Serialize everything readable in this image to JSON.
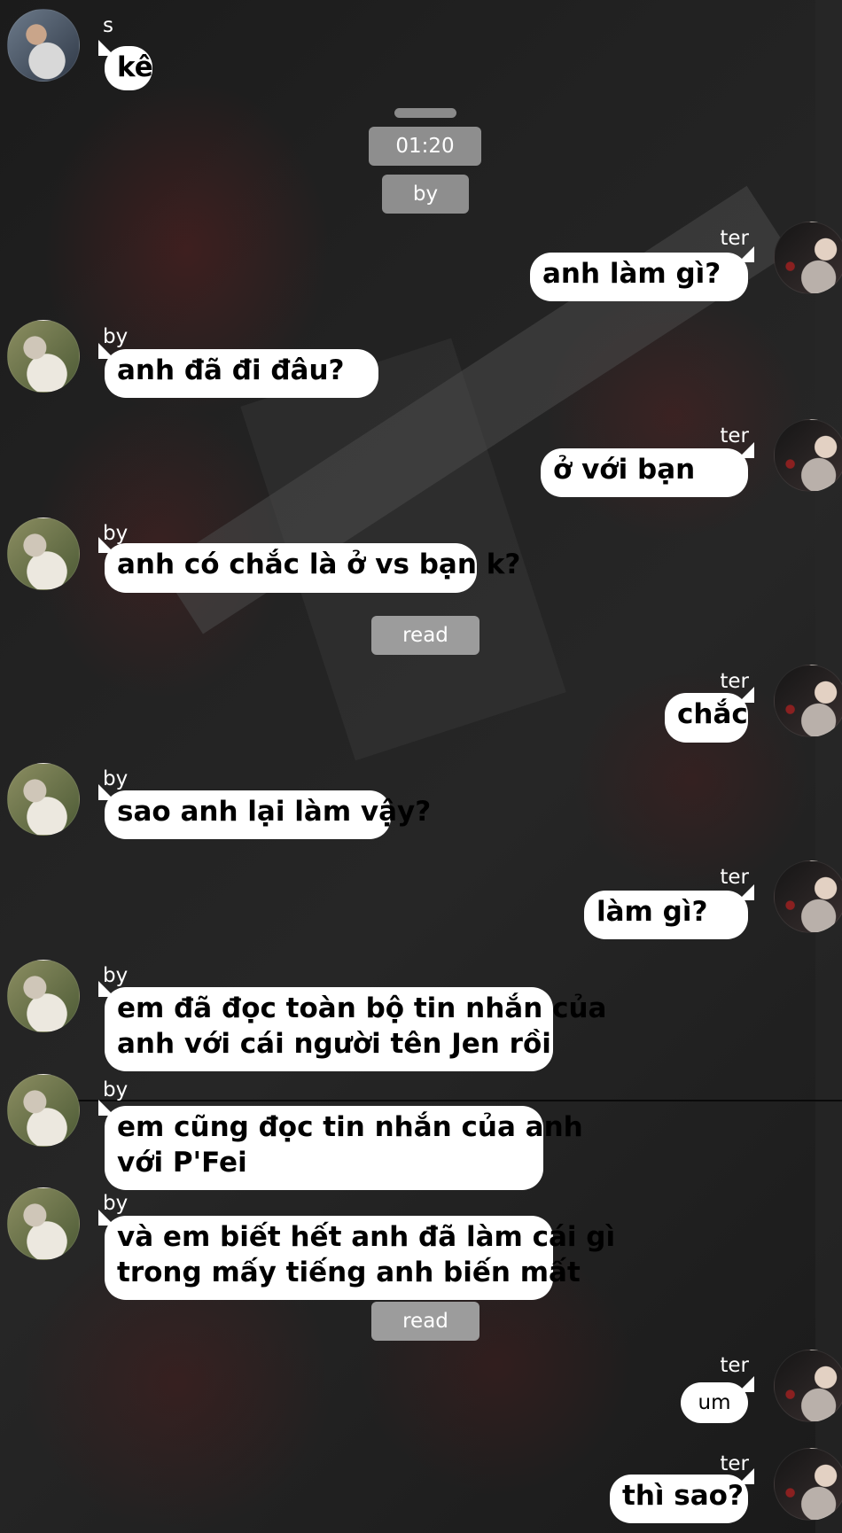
{
  "participants": {
    "s": "s",
    "by": "by",
    "ter": "ter"
  },
  "system": {
    "time": "01:20",
    "by_label": "by",
    "read_1": "read",
    "read_2": "read"
  },
  "messages": [
    {
      "sender": "s",
      "text": "kê"
    },
    {
      "sender": "ter",
      "text": "anh làm gì?"
    },
    {
      "sender": "by",
      "text": "anh đã đi đâu?"
    },
    {
      "sender": "ter",
      "text": "ở với bạn"
    },
    {
      "sender": "by",
      "text": "anh có chắc là ở vs bạn k?"
    },
    {
      "sender": "ter",
      "text": "chắc"
    },
    {
      "sender": "by",
      "text": "sao anh lại làm vậy?"
    },
    {
      "sender": "ter",
      "text": "làm gì?"
    },
    {
      "sender": "by",
      "lines": [
        "em đã đọc toàn bộ tin nhắn của",
        "anh với cái người tên Jen rồi"
      ]
    },
    {
      "sender": "by",
      "lines": [
        "em cũng đọc tin nhắn của anh",
        "với P'Fei"
      ]
    },
    {
      "sender": "by",
      "lines": [
        "và em biết hết anh đã làm cái gì",
        "trong mấy tiếng anh biến mất"
      ]
    },
    {
      "sender": "ter",
      "text": "um"
    },
    {
      "sender": "ter",
      "text": "thì sao?"
    }
  ]
}
